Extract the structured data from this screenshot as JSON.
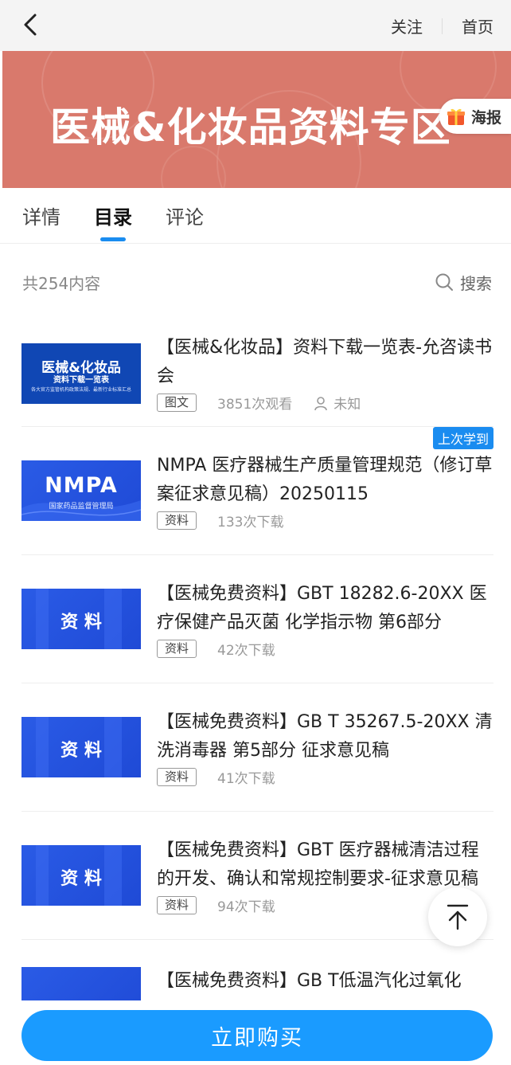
{
  "header": {
    "follow_label": "关注",
    "home_label": "首页"
  },
  "banner": {
    "title": "医械&化妆品资料专区",
    "poster_label": "海报",
    "bg_color": "#d9796c"
  },
  "tabs": [
    {
      "label": "详情"
    },
    {
      "label": "目录"
    },
    {
      "label": "评论"
    }
  ],
  "summary": {
    "count": "共254内容",
    "search_label": "搜索"
  },
  "items": [
    {
      "thumb_big": "医械&化妆品",
      "thumb_sub": "资料下载一览表",
      "thumb_small": "各大官方监管机构政策法规、最新行业标准汇总",
      "title": "【医械&化妆品】资料下载一览表-允咨读书会",
      "tag": "图文",
      "stat": "3851次观看",
      "author": "未知"
    },
    {
      "badge": "上次学到",
      "thumb_big": "NMPA",
      "thumb_small": "国家药品监督管理局",
      "title": "NMPA 医疗器械生产质量管理规范（修订草案征求意见稿）20250115",
      "tag": "资料",
      "stat": "133次下载"
    },
    {
      "thumb_big": "资 料",
      "title": "【医械免费资料】GBT 18282.6-20XX 医疗保健产品灭菌 化学指示物 第6部分",
      "tag": "资料",
      "stat": "42次下载"
    },
    {
      "thumb_big": "资 料",
      "title": "【医械免费资料】GB T 35267.5-20XX 清洗消毒器 第5部分 征求意见稿",
      "tag": "资料",
      "stat": "41次下载"
    },
    {
      "thumb_big": "资 料",
      "title": "【医械免费资料】GBT 医疗器械清洁过程的开发、确认和常规控制要求-征求意见稿",
      "tag": "资料",
      "stat": "94次下载"
    },
    {
      "title": "【医械免费资料】GB T低温汽化过氧化"
    }
  ],
  "buy_label": "立即购买",
  "colors": {
    "accent": "#1a8cf0",
    "buy": "#1a9bff"
  }
}
